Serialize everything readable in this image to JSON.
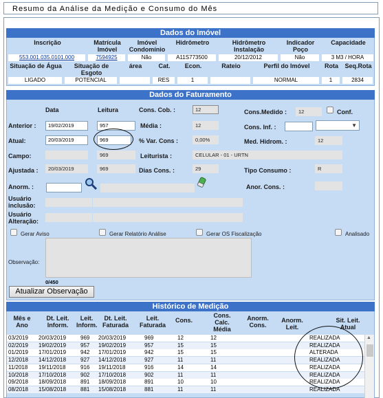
{
  "title": "Resumo da Análise da Medição e Consumo do Mês",
  "imovel": {
    "heading": "Dados do Imóvel",
    "headers1": [
      "Inscrição",
      "Matrícula Imóvel",
      "Imóvel Condomínio",
      "Hidrômetro",
      "Hidrômetro Instalação",
      "Indicador Poço",
      "Capacidade"
    ],
    "values1": [
      "553.001.035.0101.000",
      "7594925",
      "Não",
      "A11S773500",
      "20/12/2012",
      "Não",
      "3 M3 / HORA"
    ],
    "headers2": [
      "Situação de Água",
      "Situação de Esgoto",
      "área",
      "Cat.",
      "Econ.",
      "Rateio",
      "Perfil do Imóvel",
      "Rota",
      "Seq.Rota"
    ],
    "values2": [
      "LIGADO",
      "POTENCIAL",
      "",
      "RES",
      "1",
      "",
      "NORMAL",
      "1",
      "2834"
    ]
  },
  "faturamento": {
    "heading": "Dados do Faturamento",
    "col_data": "Data",
    "col_leitura": "Leitura",
    "anterior_label": "Anterior :",
    "anterior_data": "19/02/2019",
    "anterior_leitura": "957",
    "atual_label": "Atual:",
    "atual_data": "20/03/2019",
    "atual_leitura": "969",
    "campo_label": "Campo:",
    "campo_leitura": "969",
    "ajustada_label": "Ajustada :",
    "ajustada_data": "20/03/2019",
    "ajustada_leitura": "969",
    "anorm_label": "Anorm. :",
    "cons_cob_label": "Cons. Cob. :",
    "cons_cob_value": "12",
    "media_label": "Média :",
    "media_value": "12",
    "var_cons_label": "% Var. Cons :",
    "var_cons_value": "0,00%",
    "leiturista_label": "Leiturista :",
    "leiturista_value": "CELULAR - 01 - URTN",
    "dias_cons_label": "Dias Cons. :",
    "dias_cons_value": "29",
    "cons_medido_label": "Cons.Medido :",
    "cons_medido_value": "12",
    "conf_label": "Conf.",
    "cons_inf_label": "Cons. Inf. :",
    "med_hidrom_label": "Med. Hidrom. :",
    "med_hidrom_value": "12",
    "tipo_consumo_label": "Tipo Consumo :",
    "tipo_consumo_value": "R",
    "anor_cons_label": "Anor. Cons. :",
    "usuario_inclusao_label": "Usuário inclusão:",
    "usuario_alteracao_label": "Usuário Alteração:",
    "gerar_aviso": "Gerar Aviso",
    "gerar_relatorio": "Gerar Relatório Análise",
    "gerar_os": "Gerar OS Fiscalização",
    "analisado": "Analisado",
    "observacao_label": "Observação:",
    "counter": "0/450",
    "atualizar_button": "Atualizar Observação"
  },
  "historico": {
    "heading": "Histórico de Medição",
    "headers": [
      "Mês e Ano",
      "Dt. Leit. Inform.",
      "Leit. Inform.",
      "Dt. Leit. Faturada",
      "Leit. Faturada",
      "Cons.",
      "Cons. Calc. Média",
      "Anorm. Cons.",
      "Anorm. Leit.",
      "Sit. Leit. Atual"
    ],
    "rows": [
      [
        "03/2019",
        "20/03/2019",
        "969",
        "20/03/2019",
        "969",
        "12",
        "12",
        "",
        "",
        "REALIZADA"
      ],
      [
        "02/2019",
        "19/02/2019",
        "957",
        "19/02/2019",
        "957",
        "15",
        "15",
        "",
        "",
        "REALIZADA"
      ],
      [
        "01/2019",
        "17/01/2019",
        "942",
        "17/01/2019",
        "942",
        "15",
        "15",
        "",
        "",
        "ALTERADA"
      ],
      [
        "12/2018",
        "14/12/2018",
        "927",
        "14/12/2018",
        "927",
        "11",
        "11",
        "",
        "",
        "REALIZADA"
      ],
      [
        "11/2018",
        "19/11/2018",
        "916",
        "19/11/2018",
        "916",
        "14",
        "14",
        "",
        "",
        "REALIZADA"
      ],
      [
        "10/2018",
        "17/10/2018",
        "902",
        "17/10/2018",
        "902",
        "11",
        "11",
        "",
        "",
        "REALIZADA"
      ],
      [
        "09/2018",
        "18/09/2018",
        "891",
        "18/09/2018",
        "891",
        "10",
        "10",
        "",
        "",
        "REALIZADA"
      ],
      [
        "08/2018",
        "15/08/2018",
        "881",
        "15/08/2018",
        "881",
        "11",
        "11",
        "",
        "",
        "REALIZADA"
      ]
    ]
  },
  "icons": [
    "magnifier-icon",
    "eraser-icon",
    "dropdown-arrow-icon",
    "scroll-up-icon"
  ]
}
